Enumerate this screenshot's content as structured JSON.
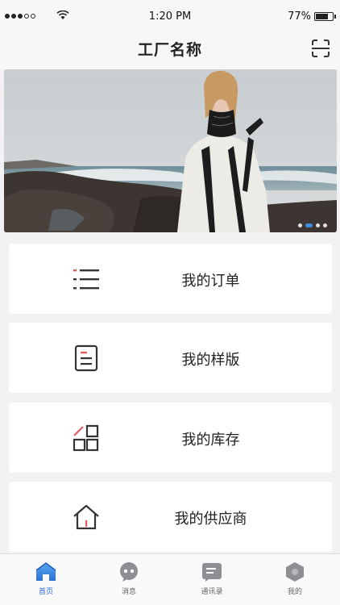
{
  "status_bar": {
    "time": "1:20 PM",
    "battery": "77%",
    "battery_level": 0.77
  },
  "header": {
    "title": "工厂名称",
    "scan_icon": "scan-icon"
  },
  "banner": {
    "slide_count": 4,
    "active_slide": 2
  },
  "menu": [
    {
      "label": "我的订单",
      "icon": "list-icon"
    },
    {
      "label": "我的样版",
      "icon": "document-icon"
    },
    {
      "label": "我的库存",
      "icon": "inventory-grid-icon"
    },
    {
      "label": "我的供应商",
      "icon": "home-icon"
    }
  ],
  "tabbar": {
    "tabs": [
      {
        "label": "首页",
        "icon": "home-tab-icon",
        "active": true
      },
      {
        "label": "消息",
        "icon": "message-icon",
        "active": false
      },
      {
        "label": "通讯录",
        "icon": "contacts-icon",
        "active": false
      },
      {
        "label": "我的",
        "icon": "profile-hexagon-icon",
        "active": false
      }
    ]
  },
  "colors": {
    "accent": "#2a6fd6",
    "icon_red": "#e25c5c",
    "icon_dark": "#333333"
  }
}
